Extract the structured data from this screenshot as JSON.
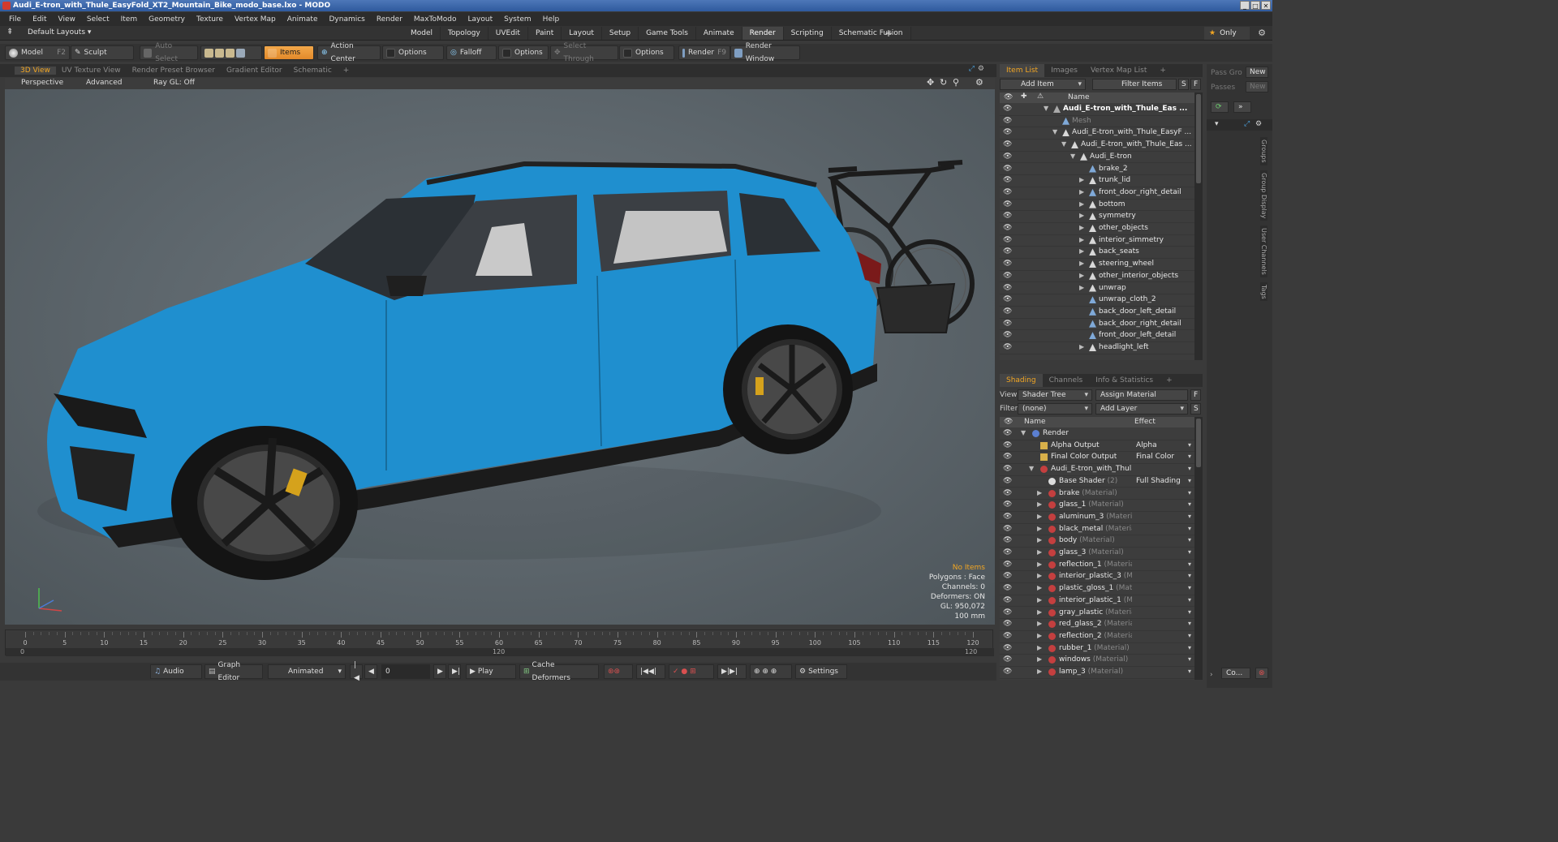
{
  "window": {
    "title": "Audi_E-tron_with_Thule_EasyFold_XT2_Mountain_Bike_modo_base.lxo - MODO",
    "buttons": [
      "_",
      "□",
      "✕"
    ]
  },
  "menu": [
    "File",
    "Edit",
    "View",
    "Select",
    "Item",
    "Geometry",
    "Texture",
    "Vertex Map",
    "Animate",
    "Dynamics",
    "Render",
    "MaxToModo",
    "Layout",
    "System",
    "Help"
  ],
  "layoutbar": {
    "layouts_label": "Default Layouts ▾",
    "tabs": [
      "Model",
      "Topology",
      "UVEdit",
      "Paint",
      "Layout",
      "Setup",
      "Game Tools",
      "Animate",
      "Render",
      "Scripting",
      "Schematic Fusion"
    ],
    "active_tab": "Render",
    "plus": "+",
    "only_label": "Only",
    "star": "★"
  },
  "toolbar": {
    "model": "Model",
    "model_key": "F2",
    "sculpt": "Sculpt",
    "auto_select": "Auto Select",
    "items": "Items",
    "action_center": "Action Center",
    "options1": "Options",
    "falloff": "Falloff",
    "options2": "Options",
    "select_through": "Select Through",
    "options3": "Options",
    "render": "Render",
    "render_key": "F9",
    "render_window": "Render Window"
  },
  "viewport": {
    "tabs": [
      "3D View",
      "UV Texture View",
      "Render Preset Browser",
      "Gradient Editor",
      "Schematic"
    ],
    "active_tab": "3D View",
    "plus": "+",
    "sub": {
      "perspective": "Perspective",
      "advanced": "Advanced",
      "raygl": "Ray GL: Off"
    },
    "info": {
      "no_items": "No Items",
      "polygons": "Polygons : Face",
      "channels": "Channels: 0",
      "deformers": "Deformers: ON",
      "gl": "GL: 950,072",
      "scale": "100 mm"
    }
  },
  "timeline": {
    "ticks": [
      "0",
      "5",
      "10",
      "15",
      "20",
      "25",
      "30",
      "35",
      "40",
      "45",
      "50",
      "55",
      "60",
      "65",
      "70",
      "75",
      "80",
      "85",
      "90",
      "95",
      "100",
      "105",
      "110",
      "115",
      "120"
    ],
    "bottom_left": "0",
    "bottom_mid": "120",
    "bottom_right": "120"
  },
  "bottombar": {
    "audio": "Audio",
    "graph_editor": "Graph Editor",
    "animated": "Animated",
    "frame": "0",
    "play": "Play",
    "cache_deformers": "Cache Deformers",
    "settings": "Settings"
  },
  "item_list": {
    "tabs": [
      "Item List",
      "Images",
      "Vertex Map List"
    ],
    "active_tab": "Item List",
    "add_item": "Add Item",
    "filter_items": "Filter Items",
    "btn_s": "S",
    "btn_f": "F",
    "header_name": "Name",
    "rows": [
      {
        "name": "Audi_E-tron_with_Thule_Eas ...",
        "indent": 0,
        "arrow": "▼",
        "bold": true,
        "icon": "scene"
      },
      {
        "name": "Mesh",
        "indent": 1,
        "arrow": "",
        "dim": true,
        "icon": "mesh"
      },
      {
        "name": "Audi_E-tron_with_Thule_EasyF ...",
        "indent": 1,
        "arrow": "▼",
        "icon": "locator"
      },
      {
        "name": "Audi_E-tron_with_Thule_Eas ...",
        "indent": 2,
        "arrow": "▼",
        "icon": "locator"
      },
      {
        "name": "Audi_E-tron",
        "indent": 3,
        "arrow": "▼",
        "icon": "locator"
      },
      {
        "name": "brake_2",
        "indent": 4,
        "arrow": "",
        "icon": "mesh"
      },
      {
        "name": "trunk_lid",
        "indent": 4,
        "arrow": "▶",
        "icon": "locator"
      },
      {
        "name": "front_door_right_detail",
        "indent": 4,
        "arrow": "▶",
        "icon": "mesh"
      },
      {
        "name": "bottom",
        "indent": 4,
        "arrow": "▶",
        "icon": "locator"
      },
      {
        "name": "symmetry",
        "indent": 4,
        "arrow": "▶",
        "icon": "locator"
      },
      {
        "name": "other_objects",
        "indent": 4,
        "arrow": "▶",
        "icon": "locator"
      },
      {
        "name": "interior_simmetry",
        "indent": 4,
        "arrow": "▶",
        "icon": "locator"
      },
      {
        "name": "back_seats",
        "indent": 4,
        "arrow": "▶",
        "icon": "locator"
      },
      {
        "name": "steering_wheel",
        "indent": 4,
        "arrow": "▶",
        "icon": "locator"
      },
      {
        "name": "other_interior_objects",
        "indent": 4,
        "arrow": "▶",
        "icon": "locator"
      },
      {
        "name": "unwrap",
        "indent": 4,
        "arrow": "▶",
        "icon": "locator"
      },
      {
        "name": "unwrap_cloth_2",
        "indent": 4,
        "arrow": "",
        "icon": "mesh"
      },
      {
        "name": "back_door_left_detail",
        "indent": 4,
        "arrow": "",
        "icon": "mesh"
      },
      {
        "name": "back_door_right_detail",
        "indent": 4,
        "arrow": "",
        "icon": "mesh"
      },
      {
        "name": "front_door_left_detail",
        "indent": 4,
        "arrow": "",
        "icon": "mesh"
      },
      {
        "name": "headlight_left",
        "indent": 4,
        "arrow": "▶",
        "icon": "locator"
      }
    ]
  },
  "shading": {
    "tabs": [
      "Shading",
      "Channels",
      "Info & Statistics"
    ],
    "active_tab": "Shading",
    "view_label": "View",
    "view_value": "Shader Tree",
    "assign_material": "Assign Material",
    "btn_f": "F",
    "filter_label": "Filter",
    "filter_value": "(none)",
    "add_layer": "Add Layer",
    "btn_s": "S",
    "header_name": "Name",
    "header_effect": "Effect",
    "rows": [
      {
        "name": "Render",
        "indent": 0,
        "arrow": "▼",
        "icon": "render",
        "effect": ""
      },
      {
        "name": "Alpha Output",
        "indent": 1,
        "arrow": "",
        "icon": "output",
        "effect": "Alpha"
      },
      {
        "name": "Final Color Output",
        "indent": 1,
        "arrow": "",
        "icon": "output",
        "effect": "Final Color"
      },
      {
        "name": "Audi_E-tron_with_Thul...",
        "indent": 1,
        "arrow": "▼",
        "icon": "material",
        "effect": ""
      },
      {
        "name": "Base Shader",
        "sub": "(2)",
        "indent": 2,
        "arrow": "",
        "icon": "shader",
        "effect": "Full Shading"
      },
      {
        "name": "brake",
        "sub": "(Material)",
        "indent": 2,
        "arrow": "▶",
        "icon": "material",
        "effect": ""
      },
      {
        "name": "glass_1",
        "sub": "(Material)",
        "indent": 2,
        "arrow": "▶",
        "icon": "material",
        "effect": ""
      },
      {
        "name": "aluminum_3",
        "sub": "(Material)",
        "indent": 2,
        "arrow": "▶",
        "icon": "material",
        "effect": ""
      },
      {
        "name": "black_metal",
        "sub": "(Material)",
        "indent": 2,
        "arrow": "▶",
        "icon": "material",
        "effect": ""
      },
      {
        "name": "body",
        "sub": "(Material)",
        "indent": 2,
        "arrow": "▶",
        "icon": "material",
        "effect": ""
      },
      {
        "name": "glass_3",
        "sub": "(Material)",
        "indent": 2,
        "arrow": "▶",
        "icon": "material",
        "effect": ""
      },
      {
        "name": "reflection_1",
        "sub": "(Material)",
        "indent": 2,
        "arrow": "▶",
        "icon": "material",
        "effect": ""
      },
      {
        "name": "interior_plastic_3",
        "sub": "(M...",
        "indent": 2,
        "arrow": "▶",
        "icon": "material",
        "effect": ""
      },
      {
        "name": "plastic_gloss_1",
        "sub": "(Mat...",
        "indent": 2,
        "arrow": "▶",
        "icon": "material",
        "effect": ""
      },
      {
        "name": "interior_plastic_1",
        "sub": "(M...",
        "indent": 2,
        "arrow": "▶",
        "icon": "material",
        "effect": ""
      },
      {
        "name": "gray_plastic",
        "sub": "(Material)",
        "indent": 2,
        "arrow": "▶",
        "icon": "material",
        "effect": ""
      },
      {
        "name": "red_glass_2",
        "sub": "(Material)",
        "indent": 2,
        "arrow": "▶",
        "icon": "material",
        "effect": ""
      },
      {
        "name": "reflection_2",
        "sub": "(Material)",
        "indent": 2,
        "arrow": "▶",
        "icon": "material",
        "effect": ""
      },
      {
        "name": "rubber_1",
        "sub": "(Material)",
        "indent": 2,
        "arrow": "▶",
        "icon": "material",
        "effect": ""
      },
      {
        "name": "windows",
        "sub": "(Material)",
        "indent": 2,
        "arrow": "▶",
        "icon": "material",
        "effect": ""
      },
      {
        "name": "lamp_3",
        "sub": "(Material)",
        "indent": 2,
        "arrow": "▶",
        "icon": "material",
        "effect": ""
      }
    ]
  },
  "far_right": {
    "pass_gro": "Pass Gro",
    "new1": "New",
    "passes": "Passes",
    "new2": "New",
    "vtabs": [
      "Groups",
      "Group Display",
      "User Channels",
      "Tags"
    ],
    "co_btn": "Co..."
  },
  "colors": {
    "accent": "#f2a623",
    "car_body": "#1f8fcf",
    "viewport_bg": "#5f686e"
  }
}
